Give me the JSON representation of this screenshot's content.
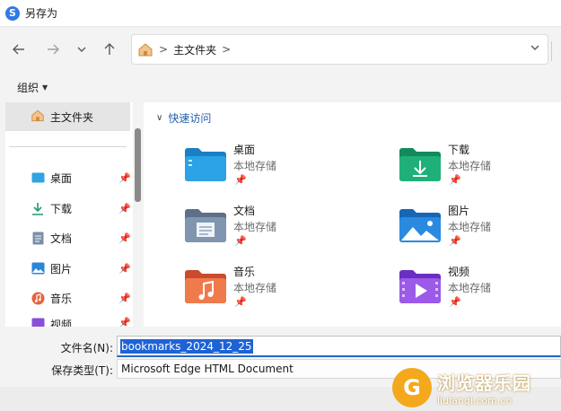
{
  "window": {
    "title": "另存为"
  },
  "nav": {
    "breadcrumb": "主文件夹",
    "separator": ">"
  },
  "command_bar": {
    "organize_label": "组织"
  },
  "sidebar": {
    "home_label": "主文件夹",
    "items": [
      {
        "label": "桌面",
        "icon": "desktop-icon"
      },
      {
        "label": "下载",
        "icon": "download-icon"
      },
      {
        "label": "文档",
        "icon": "document-icon"
      },
      {
        "label": "图片",
        "icon": "picture-icon"
      },
      {
        "label": "音乐",
        "icon": "music-icon"
      },
      {
        "label": "视频",
        "icon": "video-icon"
      }
    ]
  },
  "content": {
    "section_title": "快速访问",
    "folders": [
      {
        "name": "桌面",
        "sub": "本地存储",
        "icon": "desktop-folder-icon"
      },
      {
        "name": "下载",
        "sub": "本地存储",
        "icon": "download-folder-icon"
      },
      {
        "name": "文档",
        "sub": "本地存储",
        "icon": "document-folder-icon"
      },
      {
        "name": "图片",
        "sub": "本地存储",
        "icon": "picture-folder-icon"
      },
      {
        "name": "音乐",
        "sub": "本地存储",
        "icon": "music-folder-icon"
      },
      {
        "name": "视频",
        "sub": "本地存储",
        "icon": "video-folder-icon"
      }
    ]
  },
  "save": {
    "filename_label": "文件名(N):",
    "filename_value": "bookmarks_2024_12_25",
    "filetype_label": "保存类型(T):",
    "filetype_value": "Microsoft Edge HTML Document"
  },
  "watermark": {
    "cn": "浏览器乐园",
    "en": "liulanqi.com.cn"
  },
  "colors": {
    "accent": "#2167c6",
    "selection": "#1e63d6",
    "link": "#1f5fa8"
  }
}
